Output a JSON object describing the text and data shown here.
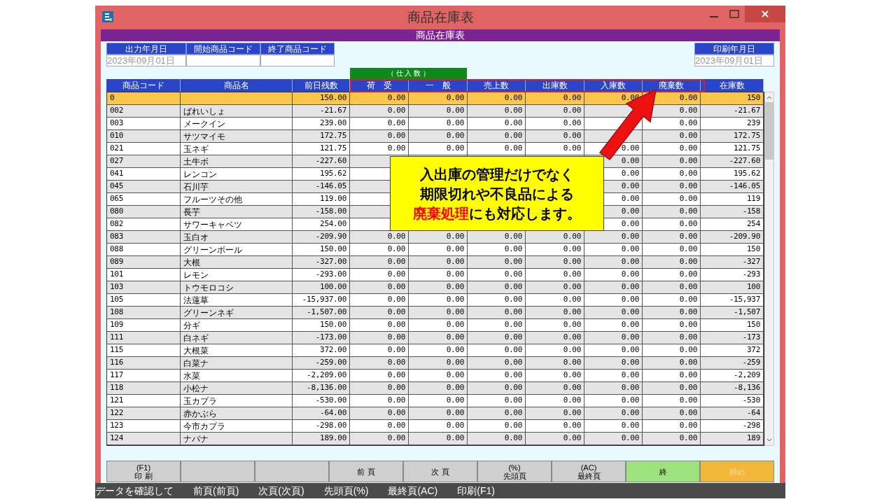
{
  "window": {
    "title": "商品在庫表"
  },
  "header_bar": "商品在庫表",
  "filters": [
    {
      "label": "出力年月日",
      "value": "2023年09月01日"
    },
    {
      "label": "開始商品コード"
    },
    {
      "label": "終了商品コード"
    }
  ],
  "print_date": {
    "label": "印刷年月日",
    "value": "2023年09月01日"
  },
  "group_header": "（ 仕 入 数 ）",
  "table": {
    "columns": [
      "商品コード",
      "商品名",
      "前日残数",
      "荷　受",
      "一　般",
      "売上数",
      "出庫数",
      "入庫数",
      "廃棄数",
      "在庫数"
    ],
    "rows": [
      {
        "selected": true,
        "cells": [
          "0",
          null,
          "150.00",
          "0.00",
          "0.00",
          "0.00",
          "0.00",
          "0.00",
          "0.00",
          "150"
        ]
      },
      {
        "selected": false,
        "cells": [
          "002",
          "ばれいしょ",
          "-21.67",
          "0.00",
          "0.00",
          "0.00",
          "0.00",
          null,
          "0.00",
          "-21.67"
        ]
      },
      {
        "selected": false,
        "cells": [
          "003",
          "メークイン",
          "239.00",
          "0.00",
          "0.00",
          "0.00",
          "0.00",
          null,
          "0.00",
          "239"
        ]
      },
      {
        "selected": false,
        "cells": [
          "010",
          "サツマイモ",
          "172.75",
          "0.00",
          "0.00",
          "0.00",
          "0.00",
          null,
          "0.00",
          "172.75"
        ]
      },
      {
        "selected": false,
        "cells": [
          "021",
          "玉ネギ",
          "121.75",
          "0.00",
          "0.00",
          "0.00",
          "0.00",
          "0.00",
          "0.00",
          "121.75"
        ]
      },
      {
        "selected": false,
        "cells": [
          "027",
          "土牛ボ",
          "-227.60",
          null,
          null,
          null,
          null,
          "0.00",
          "0.00",
          "-227.60"
        ]
      },
      {
        "selected": false,
        "cells": [
          "041",
          "レンコン",
          "195.62",
          null,
          null,
          null,
          null,
          "0.00",
          "0.00",
          "195.62"
        ]
      },
      {
        "selected": false,
        "cells": [
          "045",
          "石川芋",
          "-146.05",
          null,
          null,
          null,
          null,
          "0.00",
          "0.00",
          "-146.05"
        ]
      },
      {
        "selected": false,
        "cells": [
          "065",
          "フルーツその他",
          "119.00",
          null,
          null,
          null,
          null,
          "0.00",
          "0.00",
          "119"
        ]
      },
      {
        "selected": false,
        "cells": [
          "080",
          "長芋",
          "-158.00",
          null,
          null,
          null,
          null,
          "0.00",
          "0.00",
          "-158"
        ]
      },
      {
        "selected": false,
        "cells": [
          "082",
          "サワーキャベツ",
          "254.00",
          null,
          null,
          null,
          null,
          "0.00",
          "0.00",
          "254"
        ]
      },
      {
        "selected": false,
        "cells": [
          "083",
          "玉白オ",
          "-209.90",
          "0.00",
          "0.00",
          "0.00",
          "0.00",
          "0.00",
          "0.00",
          "-209.90"
        ]
      },
      {
        "selected": false,
        "cells": [
          "088",
          "グリーンボール",
          "150.00",
          "0.00",
          "0.00",
          "0.00",
          "0.00",
          "0.00",
          "0.00",
          "150"
        ]
      },
      {
        "selected": false,
        "cells": [
          "089",
          "大根",
          "-327.00",
          "0.00",
          "0.00",
          "0.00",
          "0.00",
          "0.00",
          "0.00",
          "-327"
        ]
      },
      {
        "selected": false,
        "cells": [
          "101",
          "レモン",
          "-293.00",
          "0.00",
          "0.00",
          "0.00",
          "0.00",
          "0.00",
          "0.00",
          "-293"
        ]
      },
      {
        "selected": false,
        "cells": [
          "103",
          "トウモロコシ",
          "100.00",
          "0.00",
          "0.00",
          "0.00",
          "0.00",
          "0.00",
          "0.00",
          "100"
        ]
      },
      {
        "selected": false,
        "cells": [
          "105",
          "法蓮草",
          "-15,937.00",
          "0.00",
          "0.00",
          "0.00",
          "0.00",
          "0.00",
          "0.00",
          "-15,937"
        ]
      },
      {
        "selected": false,
        "cells": [
          "108",
          "グリーンネギ",
          "-1,507.00",
          "0.00",
          "0.00",
          "0.00",
          "0.00",
          "0.00",
          "0.00",
          "-1,507"
        ]
      },
      {
        "selected": false,
        "cells": [
          "109",
          "分ギ",
          "150.00",
          "0.00",
          "0.00",
          "0.00",
          "0.00",
          "0.00",
          "0.00",
          "150"
        ]
      },
      {
        "selected": false,
        "cells": [
          "111",
          "白ネギ",
          "-173.00",
          "0.00",
          "0.00",
          "0.00",
          "0.00",
          "0.00",
          "0.00",
          "-173"
        ]
      },
      {
        "selected": false,
        "cells": [
          "115",
          "大根菜",
          "372.00",
          "0.00",
          "0.00",
          "0.00",
          "0.00",
          "0.00",
          "0.00",
          "372"
        ]
      },
      {
        "selected": false,
        "cells": [
          "116",
          "白菜ナ",
          "-259.00",
          "0.00",
          "0.00",
          "0.00",
          "0.00",
          "0.00",
          "0.00",
          "-259"
        ]
      },
      {
        "selected": false,
        "cells": [
          "117",
          "水菜",
          "-2,209.00",
          "0.00",
          "0.00",
          "0.00",
          "0.00",
          "0.00",
          "0.00",
          "-2,209"
        ]
      },
      {
        "selected": false,
        "cells": [
          "118",
          "小松ナ",
          "-8,136.00",
          "0.00",
          "0.00",
          "0.00",
          "0.00",
          "0.00",
          "0.00",
          "-8,136"
        ]
      },
      {
        "selected": false,
        "cells": [
          "121",
          "玉カブラ",
          "-530.00",
          "0.00",
          "0.00",
          "0.00",
          "0.00",
          "0.00",
          "0.00",
          "-530"
        ]
      },
      {
        "selected": false,
        "cells": [
          "122",
          "赤かぶら",
          "-64.00",
          "0.00",
          "0.00",
          "0.00",
          "0.00",
          "0.00",
          "0.00",
          "-64"
        ]
      },
      {
        "selected": false,
        "cells": [
          "123",
          "今市カブラ",
          "-298.00",
          "0.00",
          "0.00",
          "0.00",
          "0.00",
          "0.00",
          "0.00",
          "-298"
        ]
      },
      {
        "selected": false,
        "cells": [
          "124",
          "ナバナ",
          "189.00",
          "0.00",
          "0.00",
          "0.00",
          "0.00",
          "0.00",
          "0.00",
          "189"
        ]
      }
    ]
  },
  "callout": {
    "lines": [
      [
        {
          "text": "入出庫の管理だけでなく"
        }
      ],
      [
        {
          "text": "期限切れや不良品による"
        }
      ],
      [
        {
          "text": "廃棄処理",
          "color": "#ff0000"
        },
        {
          "text": "にも対応します。"
        }
      ]
    ]
  },
  "buttons": [
    {
      "kind": "normal",
      "lines": [
        "(F1)",
        "印 刷"
      ]
    },
    {
      "kind": "normal"
    },
    {
      "kind": "normal"
    },
    {
      "kind": "normal",
      "lines": [
        "前 頁"
      ]
    },
    {
      "kind": "normal",
      "lines": [
        "次 頁"
      ]
    },
    {
      "kind": "normal",
      "lines": [
        "(%)",
        "先頭頁"
      ]
    },
    {
      "kind": "normal",
      "lines": [
        "(AC)",
        "最終頁"
      ]
    },
    {
      "kind": "exit",
      "lines": [
        "終"
      ]
    },
    {
      "kind": "disabled",
      "lines": [
        "締め"
      ]
    }
  ],
  "status_bar": [
    "データを確認して",
    "前頁(前頁)",
    "次頁(次頁)",
    "先頭頁(%)",
    "最終頁(AC)",
    "印刷(F1)"
  ]
}
